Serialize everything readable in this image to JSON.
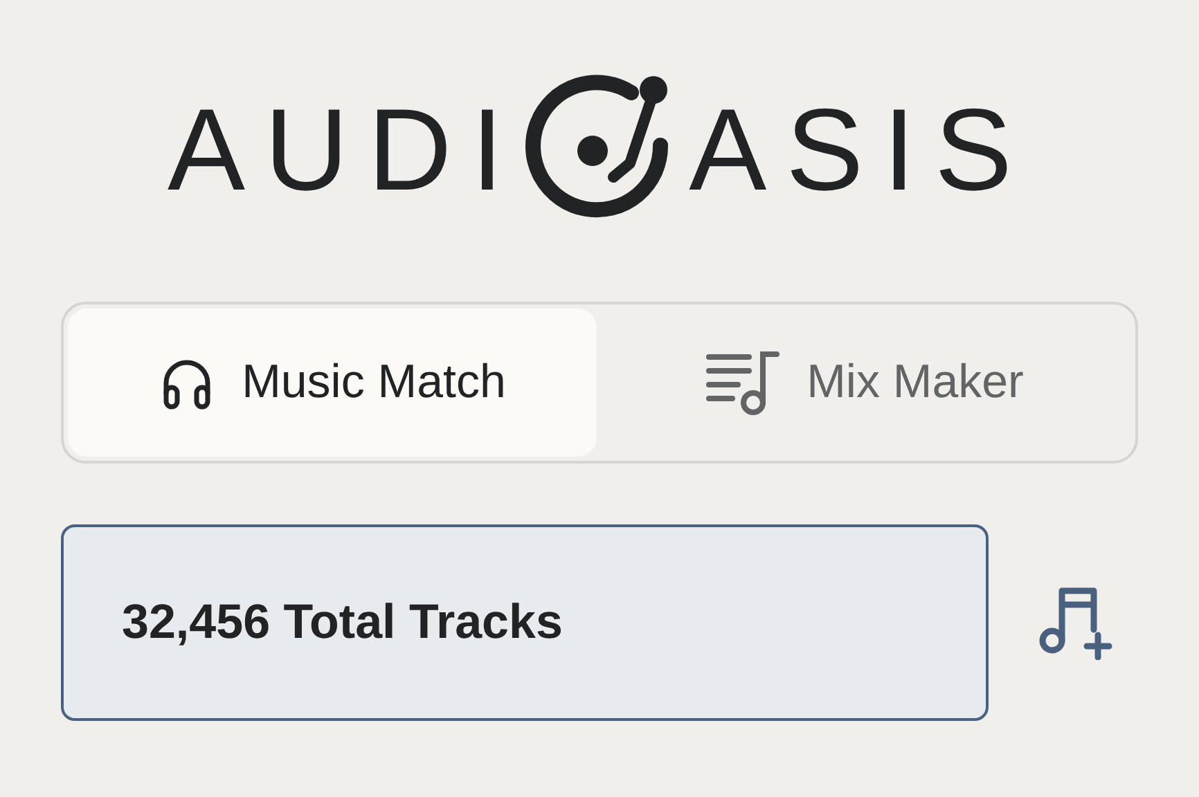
{
  "logo": {
    "left": "AUDI",
    "right": "ASIS"
  },
  "tabs": [
    {
      "label": "Music Match",
      "kind": "headphones",
      "selected": true
    },
    {
      "label": "Mix Maker",
      "kind": "playlist",
      "selected": false
    }
  ],
  "stats": {
    "text": "32,456 Total Tracks"
  }
}
